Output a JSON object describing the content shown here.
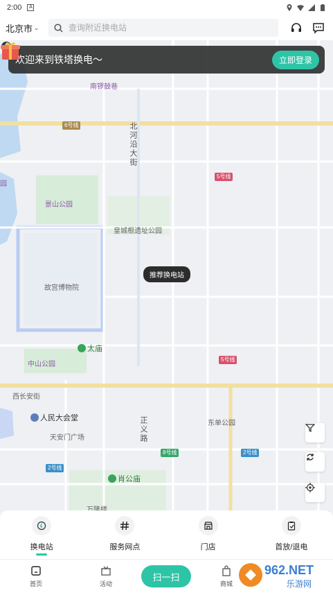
{
  "status_bar": {
    "time": "2:00",
    "notification_badge": "A"
  },
  "top_bar": {
    "city": "北京市",
    "search_placeholder": "查询附近换电站"
  },
  "banner": {
    "text": "欢迎来到铁塔换电～",
    "login_label": "立即登录"
  },
  "map": {
    "labels": {
      "nanluoguxiang": "南锣鼓巷",
      "beiheyan": "北河沿大街",
      "jingshan": "景山公园",
      "huangcheng": "皇城根遗址公园",
      "gugong": "故宫博物院",
      "zhongshan": "中山公园",
      "taimiao": "太庙",
      "xichangan": "西长安街",
      "renmin": "人民大会堂",
      "tiananmen": "天安门广场",
      "zhengyi": "正义路",
      "dongdan": "东单公园",
      "xiaogongmiao": "肖公庙",
      "wugu": "万隆楼",
      "left_yuan": "园"
    },
    "lines": {
      "l6": "6号线",
      "l5a": "5号线",
      "l5b": "5号线",
      "l8": "8号线",
      "l2a": "2号线",
      "l2b": "2号线"
    },
    "tooltip": "推荐换电站"
  },
  "categories": [
    {
      "label": "换电站",
      "icon": "battery-swap-icon",
      "active": true
    },
    {
      "label": "服务网点",
      "icon": "hash-icon",
      "active": false
    },
    {
      "label": "门店",
      "icon": "store-icon",
      "active": false
    },
    {
      "label": "首放/退电",
      "icon": "clipboard-icon",
      "active": false
    }
  ],
  "tabbar": {
    "home": "首页",
    "activity": "活动",
    "scan": "扫一扫",
    "mall": "商城"
  },
  "watermark": {
    "brand": "962.NET",
    "sub": "乐游网"
  },
  "colors": {
    "accent": "#2ec4a6",
    "road_yellow": "#f3dfa0",
    "palace_blue": "#b9cdf3",
    "park_green": "#d7ecd9"
  }
}
